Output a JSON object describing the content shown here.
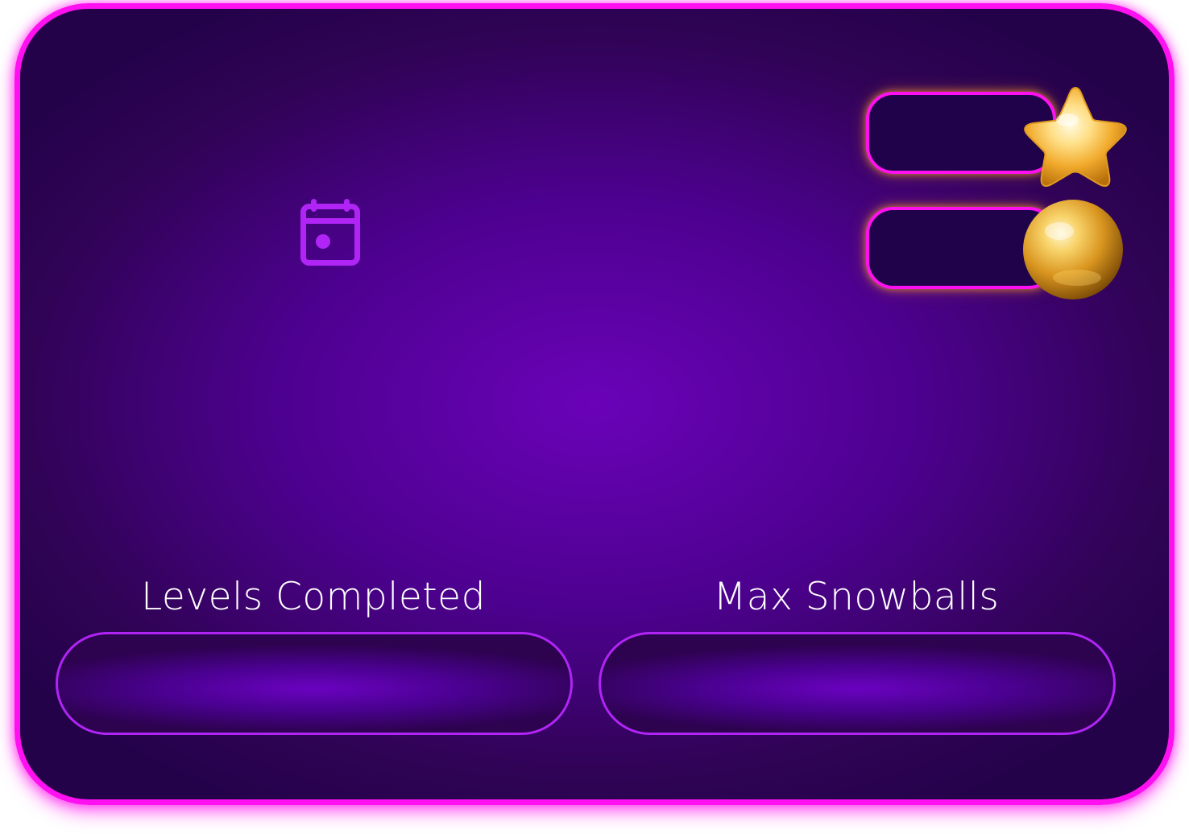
{
  "colors": {
    "frame_border": "#ff10f0",
    "panel_center": "#6a02b8",
    "panel_edge": "#24024a",
    "accent_purple": "#b025f5",
    "gold": "#f2b83a",
    "text": "#ffffff"
  },
  "icons": {
    "calendar": "calendar-icon",
    "star": "gold-star-icon",
    "snowball": "gold-ball-icon"
  },
  "currency": {
    "stars_value": "",
    "snowballs_value": ""
  },
  "stats": {
    "levels_completed": {
      "label": "Levels Completed",
      "value": ""
    },
    "max_snowballs": {
      "label": "Max Snowballs",
      "value": ""
    }
  }
}
